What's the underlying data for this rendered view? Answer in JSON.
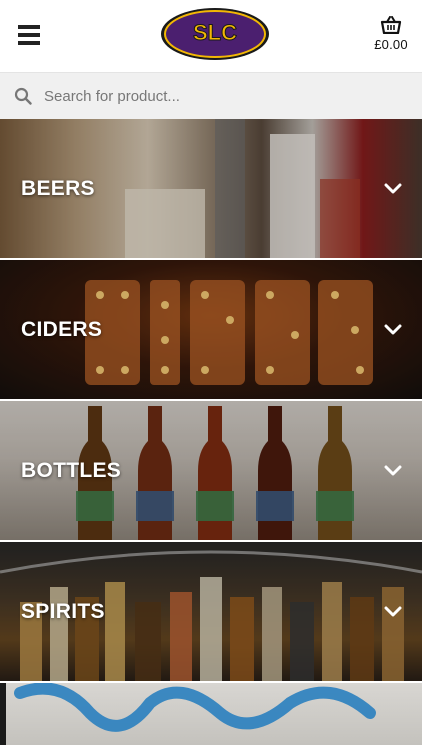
{
  "header": {
    "logo_text": "SLC",
    "basket_total": "£0.00"
  },
  "search": {
    "placeholder": "Search for product..."
  },
  "categories": [
    {
      "label": "BEERS"
    },
    {
      "label": "CIDERS"
    },
    {
      "label": "BOTTLES"
    },
    {
      "label": "SPIRITS"
    }
  ],
  "colors": {
    "logo_purple": "#4b1f6f",
    "logo_gold": "#f2b705",
    "header_bg": "#ffffff",
    "search_bg": "#f0f0f0",
    "text_dark": "#222222"
  },
  "icons": [
    "hamburger-menu-icon",
    "basket-icon",
    "search-icon",
    "chevron-down-icon"
  ]
}
